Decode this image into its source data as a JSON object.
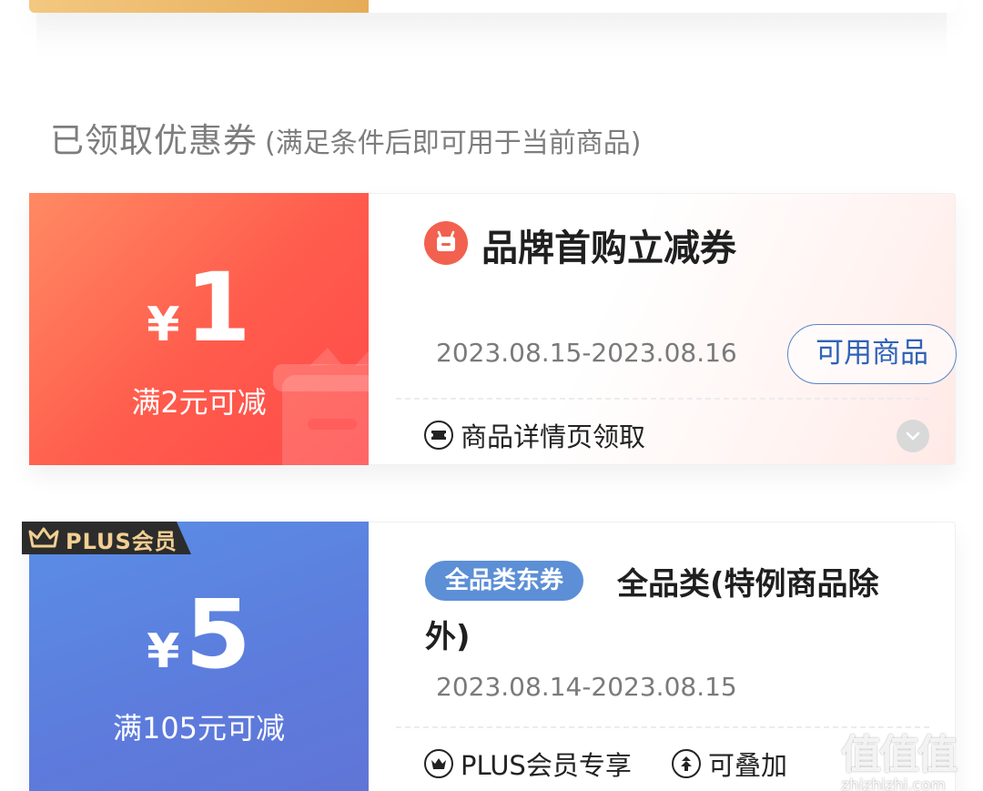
{
  "section": {
    "title": "已领取优惠券",
    "subtitle": "(满足条件后即可用于当前商品)"
  },
  "coupons": [
    {
      "currency": "¥",
      "amount": "1",
      "condition": "满2元可减",
      "title": "品牌首购立减券",
      "icon": "brand-shop-icon",
      "date_range": "2023.08.15-2023.08.16",
      "action_label": "可用商品",
      "source_icon": "ticket-icon",
      "source_label": "商品详情页领取",
      "expand_icon": "chevron-down-icon",
      "theme_color": "#ff5b4c"
    },
    {
      "badge": "PLUS会员",
      "badge_icon": "crown-icon",
      "currency": "¥",
      "amount": "5",
      "condition": "满105元可减",
      "tag": "全品类东券",
      "title_line1": "全品类(特例商品除",
      "title_line2": "外)",
      "date_range": "2023.08.14-2023.08.15",
      "feature1_icon": "crown-icon",
      "feature1_label": "PLUS会员专享",
      "feature2_icon": "stack-icon",
      "feature2_label": "可叠加",
      "theme_color": "#5d7bdc"
    }
  ],
  "watermark": {
    "glyphs": "值值值",
    "url": "zhizhizhi.com"
  },
  "colors": {
    "accent_blue": "#2f62b8",
    "tag_blue": "#5c8fd6",
    "badge_gold": "#f2cf92"
  }
}
